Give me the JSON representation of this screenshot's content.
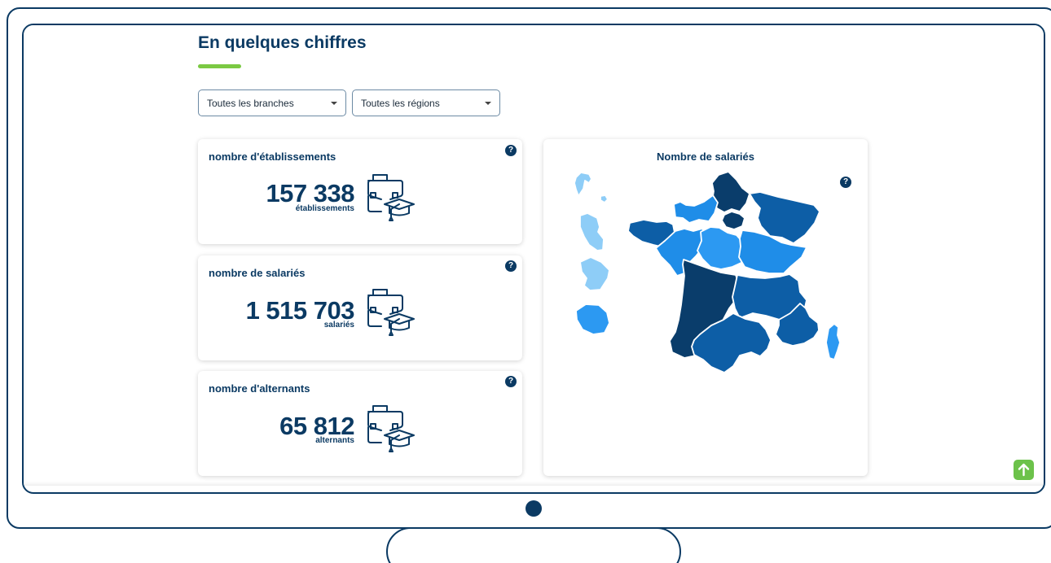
{
  "header": {
    "title": "En quelques chiffres"
  },
  "filters": {
    "branches": {
      "selected": "Toutes les branches"
    },
    "regions": {
      "selected": "Toutes les régions"
    }
  },
  "stats": [
    {
      "title": "nombre d'établissements",
      "value": "157 338",
      "unit": "établissements"
    },
    {
      "title": "nombre de salariés",
      "value": "1 515 703",
      "unit": "salariés"
    },
    {
      "title": "nombre d'alternants",
      "value": "65 812",
      "unit": "alternants"
    }
  ],
  "map": {
    "title": "Nombre de salariés"
  },
  "help_glyph": "?",
  "colors": {
    "primary": "#0b3a63",
    "accent_green": "#7bc943",
    "map_darkest": "#0a3d6b",
    "map_dark": "#0d5ea6",
    "map_mid": "#1f8de8",
    "map_light": "#2c99f2",
    "map_pale": "#8ecdf7"
  },
  "icons": {
    "stat": "briefcase-graduation-icon",
    "help": "question-icon",
    "scroll_top": "arrow-up-icon"
  }
}
